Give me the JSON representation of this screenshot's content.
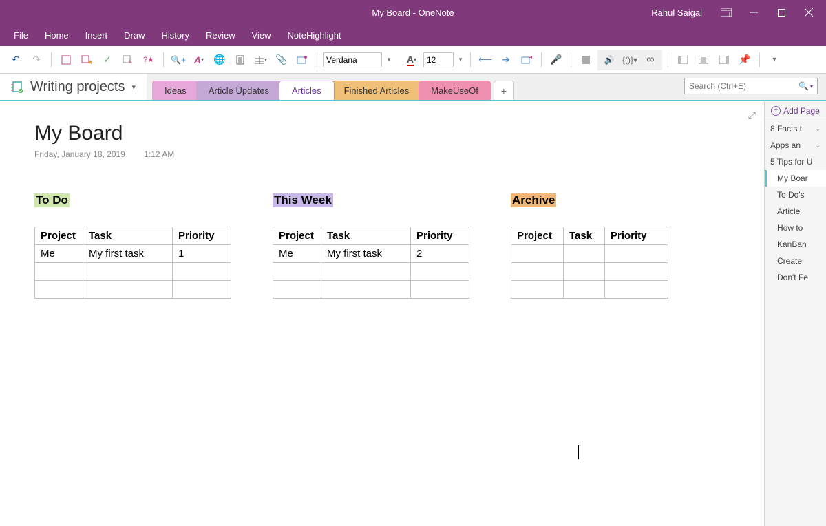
{
  "window": {
    "title": "My Board  -  OneNote",
    "user": "Rahul Saigal"
  },
  "menu": [
    "File",
    "Home",
    "Insert",
    "Draw",
    "History",
    "Review",
    "View",
    "NoteHighlight"
  ],
  "toolbar": {
    "font": "Verdana",
    "size": "12"
  },
  "notebook": "Writing projects",
  "tabs": [
    {
      "label": "Ideas",
      "cls": "ideas"
    },
    {
      "label": "Article Updates",
      "cls": "updates"
    },
    {
      "label": "Articles",
      "cls": "articles"
    },
    {
      "label": "Finished Articles",
      "cls": "finished"
    },
    {
      "label": "MakeUseOf",
      "cls": "makeuseof"
    }
  ],
  "search": {
    "placeholder": "Search (Ctrl+E)"
  },
  "page": {
    "title": "My Board",
    "date": "Friday, January 18, 2019",
    "time": "1:12 AM"
  },
  "columns": [
    {
      "title": "To Do",
      "highlight": "hl-green",
      "headers": [
        "Project",
        "Task",
        "Priority"
      ],
      "widths": [
        70,
        130,
        85
      ],
      "rows": [
        [
          "Me",
          "My first task",
          "1"
        ],
        [
          "",
          "",
          ""
        ],
        [
          "",
          "",
          ""
        ]
      ]
    },
    {
      "title": "This Week",
      "highlight": "hl-purple",
      "headers": [
        "Project",
        "Task",
        "Priority"
      ],
      "widths": [
        70,
        130,
        85
      ],
      "rows": [
        [
          "Me",
          "My first task",
          "2"
        ],
        [
          "",
          "",
          ""
        ],
        [
          "",
          "",
          ""
        ]
      ]
    },
    {
      "title": "Archive",
      "highlight": "hl-orange",
      "headers": [
        "Project",
        "Task",
        "Priority"
      ],
      "widths": [
        76,
        60,
        92
      ],
      "rows": [
        [
          "",
          "",
          ""
        ],
        [
          "",
          "",
          ""
        ],
        [
          "",
          "",
          ""
        ]
      ]
    }
  ],
  "addPage": "Add Page",
  "pages": [
    {
      "label": "8 Facts t",
      "chev": true
    },
    {
      "label": "Apps an",
      "chev": true
    },
    {
      "label": "5 Tips for U"
    },
    {
      "label": "My Boar",
      "indent": true,
      "selected": true
    },
    {
      "label": "To Do's",
      "indent": true
    },
    {
      "label": "Article",
      "indent": true
    },
    {
      "label": "How to",
      "indent": true
    },
    {
      "label": "KanBan",
      "indent": true
    },
    {
      "label": "Create",
      "indent": true
    },
    {
      "label": "Don't Fe",
      "indent": true
    }
  ]
}
